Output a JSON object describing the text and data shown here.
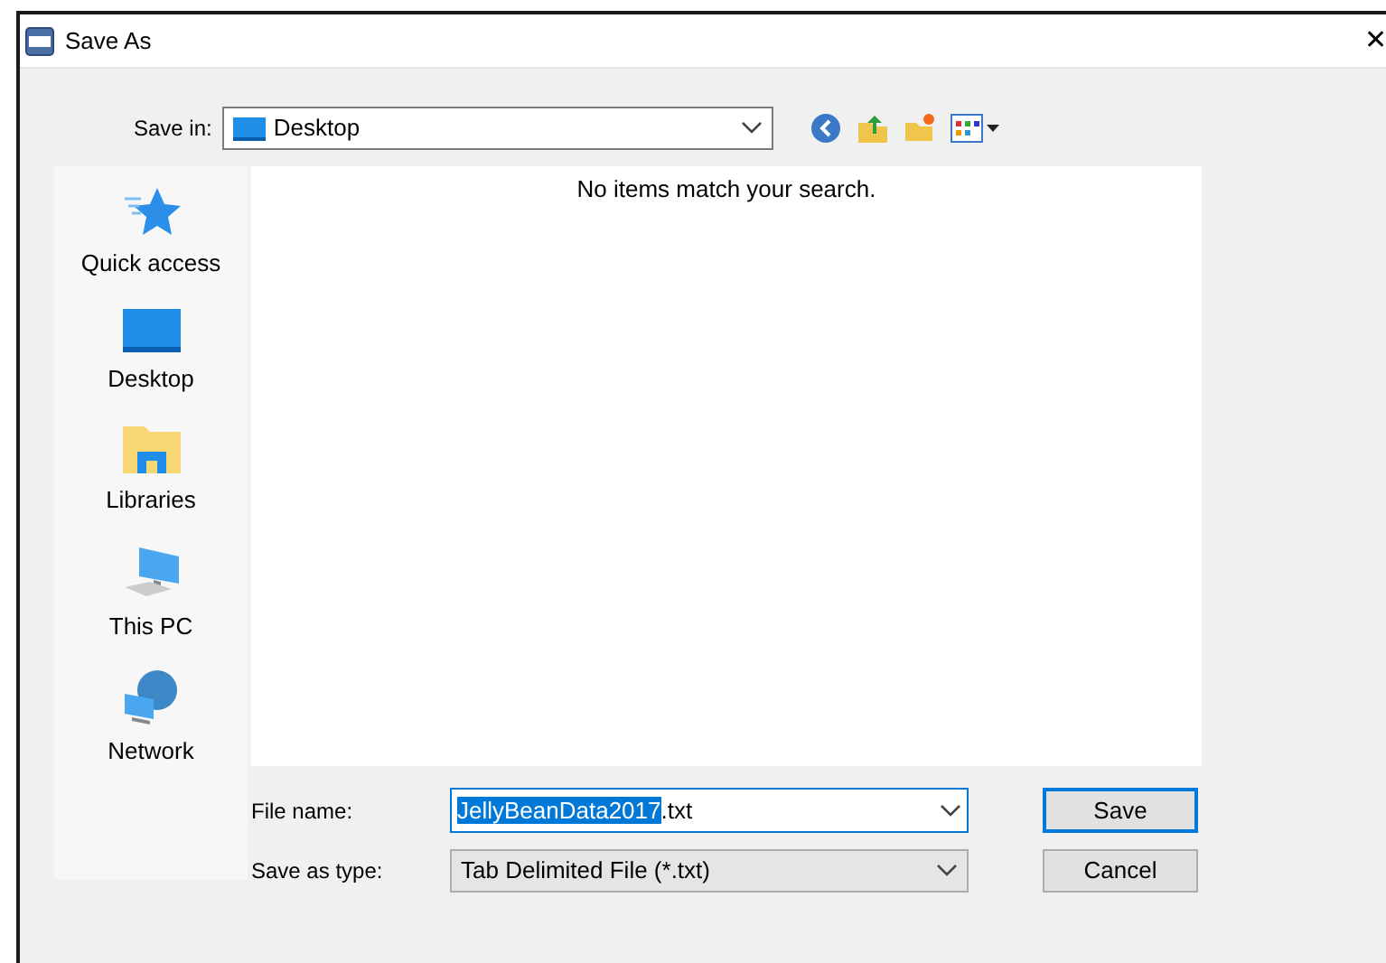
{
  "window": {
    "title": "Save As",
    "close": "✕"
  },
  "save_in": {
    "label": "Save in:",
    "value": "Desktop"
  },
  "sidebar": {
    "items": [
      {
        "label": "Quick access",
        "kind": "star",
        "selected": false
      },
      {
        "label": "Desktop",
        "kind": "desktop",
        "selected": false
      },
      {
        "label": "Libraries",
        "kind": "libraries",
        "selected": false
      },
      {
        "label": "This PC",
        "kind": "pc",
        "selected": false
      },
      {
        "label": "Network",
        "kind": "network",
        "selected": false
      }
    ]
  },
  "file_list": {
    "empty_message": "No items match your search."
  },
  "file_name": {
    "label": "File name:",
    "selected_text": "JellyBeanData2017",
    "rest_text": ".txt"
  },
  "save_as_type": {
    "label": "Save as type:",
    "value": "Tab Delimited File (*.txt)"
  },
  "buttons": [
    {
      "label": "Save",
      "default": true
    },
    {
      "label": "Cancel",
      "default": false
    }
  ]
}
